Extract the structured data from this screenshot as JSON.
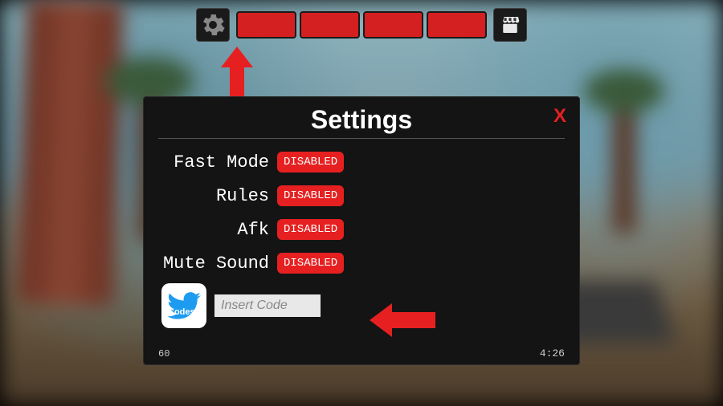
{
  "panel": {
    "title": "Settings",
    "close": "X"
  },
  "settings": [
    {
      "label": "Fast Mode",
      "status": "DISABLED"
    },
    {
      "label": "Rules",
      "status": "DISABLED"
    },
    {
      "label": "Afk",
      "status": "DISABLED"
    },
    {
      "label": "Mute Sound",
      "status": "DISABLED"
    }
  ],
  "codes": {
    "icon_label": "Codes",
    "placeholder": "Insert Code"
  },
  "footer": {
    "fps": "60",
    "time": "4:26"
  },
  "colors": {
    "accent_red": "#e62020",
    "panel_bg": "#141414"
  }
}
